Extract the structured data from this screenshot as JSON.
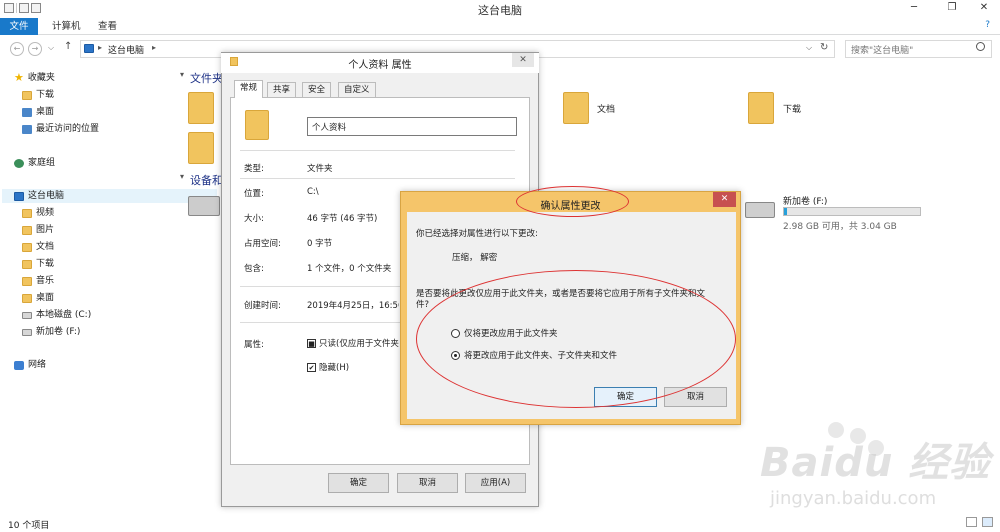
{
  "window": {
    "title": "这台电脑",
    "controls": {
      "minimize": "─",
      "restore": "❐",
      "close": "✕"
    }
  },
  "ribbon": {
    "tabs": [
      "文件",
      "计算机",
      "查看"
    ],
    "help": "?"
  },
  "address": {
    "path": "这台电脑",
    "arrow": "▸",
    "dropdown": "⌵",
    "refresh": "↻",
    "search_placeholder": "搜索\"这台电脑\"",
    "back": "←",
    "forward": "→",
    "up": "↑",
    "history": "⌵"
  },
  "nav": {
    "favorites": "收藏夹",
    "favorite_items": [
      "下载",
      "桌面",
      "最近访问的位置"
    ],
    "homegroup": "家庭组",
    "thispc": "这台电脑",
    "thispc_items": [
      "视频",
      "图片",
      "文档",
      "下载",
      "音乐",
      "桌面",
      "本地磁盘 (C:)",
      "新加卷 (F:)"
    ],
    "network": "网络"
  },
  "content": {
    "section_folders": "文件夹",
    "section_devices": "设备和",
    "folders": [
      "文档",
      "下载"
    ],
    "drive": {
      "name": "新加卷 (F:)",
      "info": "2.98 GB 可用，共 3.04 GB",
      "used_fraction": 0.02
    }
  },
  "status": {
    "items": "10 个项目"
  },
  "properties": {
    "title": "个人资料 属性",
    "close": "✕",
    "tabs": [
      "常规",
      "共享",
      "安全",
      "自定义"
    ],
    "name": "个人资料",
    "rows": [
      {
        "label": "类型:",
        "value": "文件夹"
      },
      {
        "label": "位置:",
        "value": "C:\\"
      },
      {
        "label": "大小:",
        "value": "46 字节 (46 字节)"
      },
      {
        "label": "占用空间:",
        "value": "0 字节"
      },
      {
        "label": "包含:",
        "value": "1 个文件，0 个文件夹"
      },
      {
        "label": "创建时间:",
        "value": "2019年4月25日，16:56"
      },
      {
        "label": "属性:",
        "value": "只读(仅应用于文件夹"
      }
    ],
    "readonly_check": "■",
    "hidden_check": "✔",
    "hidden": "隐藏(H)",
    "buttons": {
      "ok": "确定",
      "cancel": "取消",
      "apply": "应用(A)"
    }
  },
  "confirm": {
    "title": "确认属性更改",
    "close": "✕",
    "intro": "你已经选择对属性进行以下更改:",
    "change": "压缩， 解密",
    "question_line1": "是否要将此更改仅应用于此文件夹，或者是否要将它应用于所有子文件夹和文",
    "question_line2": "件?",
    "option1": "仅将更改应用于此文件夹",
    "option2": "将更改应用于此文件夹、子文件夹和文件",
    "buttons": {
      "ok": "确定",
      "cancel": "取消"
    }
  },
  "watermark": {
    "logo": "Baidu 经验",
    "url": "jingyan.baidu.com"
  },
  "colors": {
    "accent": "#1979ca",
    "confirm_frame": "#f5c56a",
    "annotation": "#dd3333"
  }
}
